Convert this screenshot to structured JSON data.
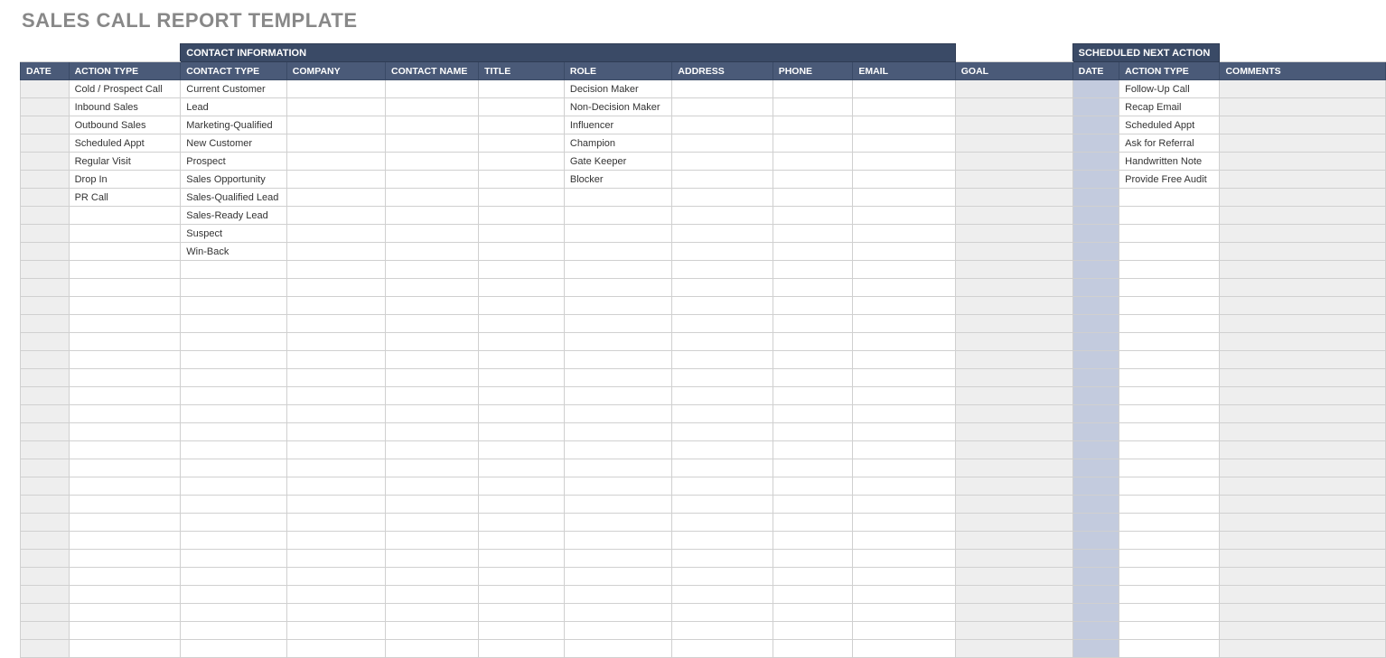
{
  "title": "SALES CALL REPORT TEMPLATE",
  "group_headers": {
    "contact_info": "CONTACT INFORMATION",
    "scheduled_next_action": "SCHEDULED NEXT ACTION"
  },
  "columns": {
    "date": "DATE",
    "action_type": "ACTION TYPE",
    "contact_type": "CONTACT TYPE",
    "company": "COMPANY",
    "contact_name": "CONTACT NAME",
    "title": "TITLE",
    "role": "ROLE",
    "address": "ADDRESS",
    "phone": "PHONE",
    "email": "EMAIL",
    "goal": "GOAL",
    "sna_date": "DATE",
    "sna_action_type": "ACTION TYPE",
    "comments": "COMMENTS"
  },
  "rows": [
    {
      "date": "",
      "action_type": "Cold / Prospect Call",
      "contact_type": "Current Customer",
      "company": "",
      "contact_name": "",
      "title": "",
      "role": "Decision Maker",
      "address": "",
      "phone": "",
      "email": "",
      "goal": "",
      "sna_date": "",
      "sna_action_type": "Follow-Up Call",
      "comments": ""
    },
    {
      "date": "",
      "action_type": "Inbound Sales",
      "contact_type": "Lead",
      "company": "",
      "contact_name": "",
      "title": "",
      "role": "Non-Decision Maker",
      "address": "",
      "phone": "",
      "email": "",
      "goal": "",
      "sna_date": "",
      "sna_action_type": "Recap Email",
      "comments": ""
    },
    {
      "date": "",
      "action_type": "Outbound Sales",
      "contact_type": "Marketing-Qualified",
      "company": "",
      "contact_name": "",
      "title": "",
      "role": "Influencer",
      "address": "",
      "phone": "",
      "email": "",
      "goal": "",
      "sna_date": "",
      "sna_action_type": "Scheduled Appt",
      "comments": ""
    },
    {
      "date": "",
      "action_type": "Scheduled Appt",
      "contact_type": "New Customer",
      "company": "",
      "contact_name": "",
      "title": "",
      "role": "Champion",
      "address": "",
      "phone": "",
      "email": "",
      "goal": "",
      "sna_date": "",
      "sna_action_type": "Ask for Referral",
      "comments": ""
    },
    {
      "date": "",
      "action_type": "Regular Visit",
      "contact_type": "Prospect",
      "company": "",
      "contact_name": "",
      "title": "",
      "role": "Gate Keeper",
      "address": "",
      "phone": "",
      "email": "",
      "goal": "",
      "sna_date": "",
      "sna_action_type": "Handwritten Note",
      "comments": ""
    },
    {
      "date": "",
      "action_type": "Drop In",
      "contact_type": "Sales Opportunity",
      "company": "",
      "contact_name": "",
      "title": "",
      "role": "Blocker",
      "address": "",
      "phone": "",
      "email": "",
      "goal": "",
      "sna_date": "",
      "sna_action_type": "Provide Free Audit",
      "comments": ""
    },
    {
      "date": "",
      "action_type": "PR Call",
      "contact_type": "Sales-Qualified Lead",
      "company": "",
      "contact_name": "",
      "title": "",
      "role": "",
      "address": "",
      "phone": "",
      "email": "",
      "goal": "",
      "sna_date": "",
      "sna_action_type": "",
      "comments": ""
    },
    {
      "date": "",
      "action_type": "",
      "contact_type": "Sales-Ready Lead",
      "company": "",
      "contact_name": "",
      "title": "",
      "role": "",
      "address": "",
      "phone": "",
      "email": "",
      "goal": "",
      "sna_date": "",
      "sna_action_type": "",
      "comments": ""
    },
    {
      "date": "",
      "action_type": "",
      "contact_type": "Suspect",
      "company": "",
      "contact_name": "",
      "title": "",
      "role": "",
      "address": "",
      "phone": "",
      "email": "",
      "goal": "",
      "sna_date": "",
      "sna_action_type": "",
      "comments": ""
    },
    {
      "date": "",
      "action_type": "",
      "contact_type": "Win-Back",
      "company": "",
      "contact_name": "",
      "title": "",
      "role": "",
      "address": "",
      "phone": "",
      "email": "",
      "goal": "",
      "sna_date": "",
      "sna_action_type": "",
      "comments": ""
    }
  ],
  "blank_row_count": 22,
  "colors": {
    "header_dark": "#3a4a66",
    "header_mid": "#4a5a78",
    "grey_fill": "#eeeeee",
    "blue_fill": "#c3cbde"
  }
}
